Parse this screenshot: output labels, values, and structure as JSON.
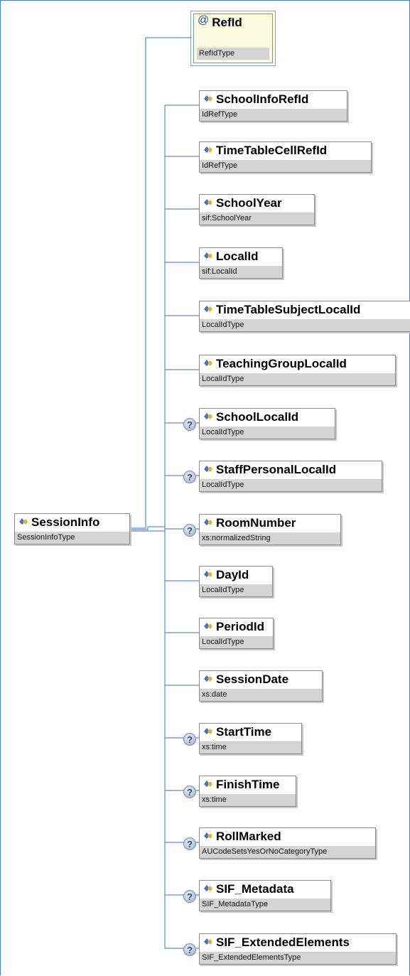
{
  "root": {
    "name": "SessionInfo",
    "type": "SessionInfoType"
  },
  "attribute": {
    "name": "RefId",
    "type": "RefIdType"
  },
  "children": [
    {
      "name": "SchoolInfoRefId",
      "type": "IdRefType",
      "optional": false
    },
    {
      "name": "TimeTableCellRefId",
      "type": "IdRefType",
      "optional": false
    },
    {
      "name": "SchoolYear",
      "type": "sif:SchoolYear",
      "optional": false
    },
    {
      "name": "LocalId",
      "type": "sif:LocalId",
      "optional": false
    },
    {
      "name": "TimeTableSubjectLocalId",
      "type": "LocalIdType",
      "optional": false
    },
    {
      "name": "TeachingGroupLocalId",
      "type": "LocalIdType",
      "optional": false
    },
    {
      "name": "SchoolLocalId",
      "type": "LocalIdType",
      "optional": true
    },
    {
      "name": "StaffPersonalLocalId",
      "type": "LocalIdType",
      "optional": true
    },
    {
      "name": "RoomNumber",
      "type": "xs:normalizedString",
      "optional": true
    },
    {
      "name": "DayId",
      "type": "LocalIdType",
      "optional": false
    },
    {
      "name": "PeriodId",
      "type": "LocalIdType",
      "optional": false
    },
    {
      "name": "SessionDate",
      "type": "xs:date",
      "optional": false
    },
    {
      "name": "StartTime",
      "type": "xs:time",
      "optional": true
    },
    {
      "name": "FinishTime",
      "type": "xs:time",
      "optional": true
    },
    {
      "name": "RollMarked",
      "type": "AUCodeSetsYesOrNoCategoryType",
      "optional": true
    },
    {
      "name": "SIF_Metadata",
      "type": "SIF_MetadataType",
      "optional": true
    },
    {
      "name": "SIF_ExtendedElements",
      "type": "SIF_ExtendedElementsType",
      "optional": true
    }
  ],
  "optional_marker": "?",
  "colors": {
    "line": "#3d6fb5",
    "type_bar": "#d4d4d4",
    "attr_bg": "#fbfbe0"
  }
}
